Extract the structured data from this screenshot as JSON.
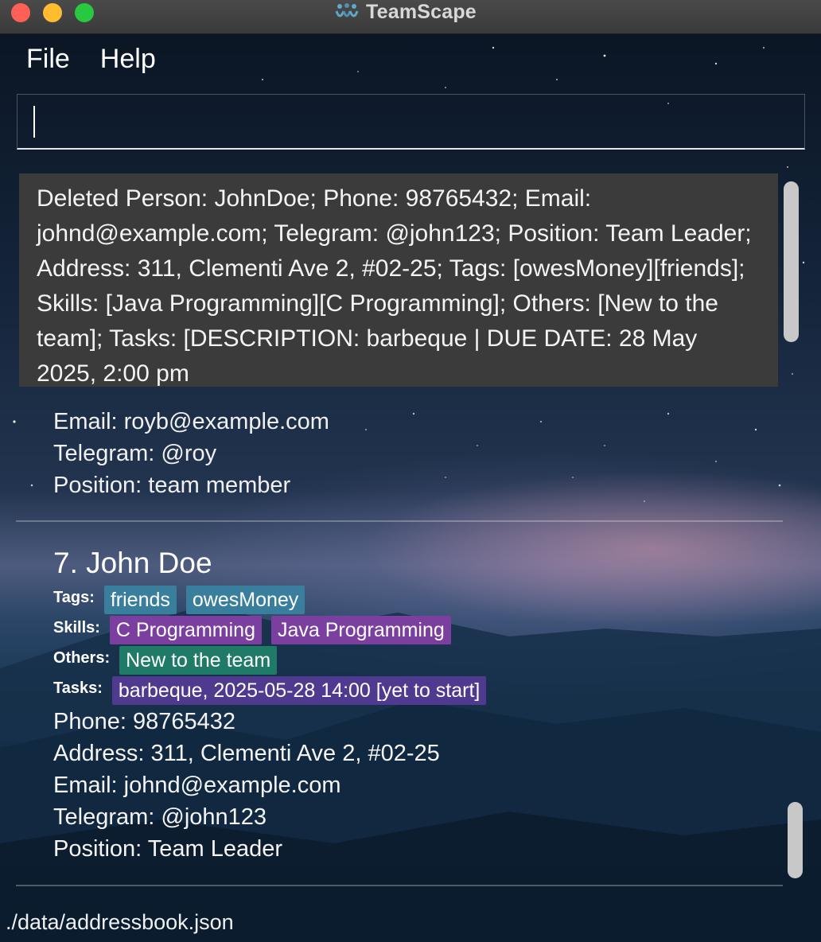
{
  "window": {
    "title": "TeamScape"
  },
  "menu": {
    "items": [
      "File",
      "Help"
    ]
  },
  "command": {
    "value": "",
    "placeholder": ""
  },
  "result": {
    "text": "Deleted Person: JohnDoe; Phone: 98765432; Email: johnd@example.com; Telegram: @john123; Position: Team Leader; Address: 311, Clementi Ave 2, #02-25; Tags: [owesMoney][friends]; Skills: [Java Programming][C Programming]; Others: [New to the team]; Tasks: [DESCRIPTION: barbeque | DUE DATE: 28 May 2025, 2:00 pm"
  },
  "previous_card": {
    "email": "Email: royb@example.com",
    "telegram": "Telegram: @roy",
    "position": "Position: team member"
  },
  "card": {
    "name": "7. John Doe",
    "tags_label": "Tags:",
    "tags": [
      "friends",
      "owesMoney"
    ],
    "skills_label": "Skills:",
    "skills": [
      "C Programming",
      "Java Programming"
    ],
    "others_label": "Others:",
    "others": [
      "New to the team"
    ],
    "tasks_label": "Tasks:",
    "tasks": [
      "barbeque, 2025-05-28 14:00 [yet to start]"
    ],
    "phone": "Phone: 98765432",
    "address": "Address: 311, Clementi Ave 2, #02-25",
    "email": "Email: johnd@example.com",
    "telegram": "Telegram: @john123",
    "position": "Position: Team Leader"
  },
  "status_bar": {
    "path": "./data/addressbook.json"
  },
  "colors": {
    "tag": "#3a7e9d",
    "skill": "#7b3fa0",
    "other": "#1f7a68",
    "task": "#4f3a8f",
    "result_bg": "#3b3b3b"
  },
  "icons": {
    "app": "teamscape-people-icon"
  }
}
